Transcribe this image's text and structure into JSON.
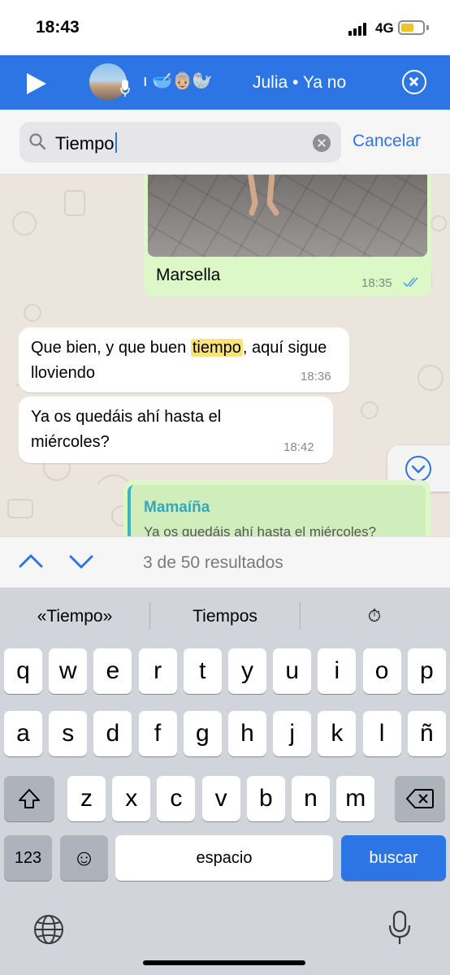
{
  "status_bar": {
    "time": "18:43",
    "network": "4G"
  },
  "voice_bar": {
    "chat_emojis": "ı 🥣👵🏼🦭",
    "title": "Julia • Ya no"
  },
  "search": {
    "query": "Tiempo",
    "cancel_label": "Cancelar"
  },
  "messages": [
    {
      "type": "image",
      "direction": "out",
      "caption": "Marsella",
      "time": "18:35",
      "status": "read"
    },
    {
      "type": "text",
      "direction": "in",
      "before": "Que bien, y que buen ",
      "highlight": "tiempo",
      "after": ",  aquí sigue lloviendo",
      "time": "18:36"
    },
    {
      "type": "text",
      "direction": "in",
      "text": "Ya os quedáis ahí hasta el miércoles?",
      "time": "18:42"
    },
    {
      "type": "reply",
      "direction": "out",
      "quoted_author": "Mamaíña",
      "quoted_text": "Ya os quedáis ahí hasta el miércoles?"
    }
  ],
  "results": {
    "count_text": "3 de 50 resultados"
  },
  "keyboard": {
    "suggestions": [
      "«Tiempo»",
      "Tiempos",
      "⏱"
    ],
    "row1": [
      "q",
      "w",
      "e",
      "r",
      "t",
      "y",
      "u",
      "i",
      "o",
      "p"
    ],
    "row2": [
      "a",
      "s",
      "d",
      "f",
      "g",
      "h",
      "j",
      "k",
      "l",
      "ñ"
    ],
    "row3": [
      "z",
      "x",
      "c",
      "v",
      "b",
      "n",
      "m"
    ],
    "numbers_label": "123",
    "space_label": "espacio",
    "search_label": "buscar",
    "emoji_glyph": "☺"
  },
  "colors": {
    "accent": "#2d74e5",
    "outgoing_bubble": "#dcf8c6",
    "highlight": "#fbe27a",
    "chat_bg": "#ece5dd"
  }
}
